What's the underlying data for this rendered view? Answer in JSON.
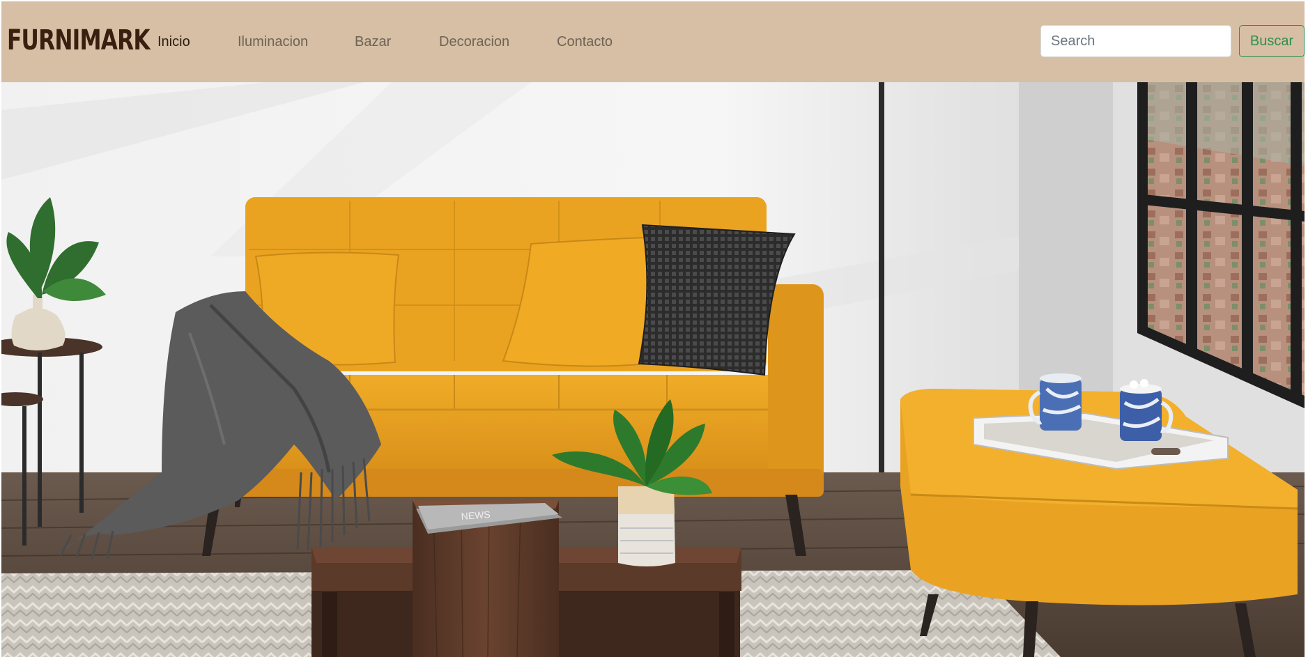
{
  "navbar": {
    "brand": "FURNIMARK",
    "links": [
      {
        "label": "Inicio",
        "active": true
      },
      {
        "label": "Iluminacion",
        "active": false
      },
      {
        "label": "Bazar",
        "active": false
      },
      {
        "label": "Decoracion",
        "active": false
      },
      {
        "label": "Contacto",
        "active": false
      }
    ],
    "search": {
      "placeholder": "Search",
      "value": ""
    },
    "search_button_label": "Buscar"
  },
  "hero": {
    "image_alt": "Sala con sofá amarillo, mesa de centro de madera y otomana",
    "magazine_text": "NEWS"
  },
  "colors": {
    "navbar_bg": "#d6bfa4",
    "brand": "#3a1f10",
    "link": "#6f6256",
    "link_active": "#2b1c12",
    "button_accent": "#2f8f4e",
    "sofa": "#eaa321"
  }
}
